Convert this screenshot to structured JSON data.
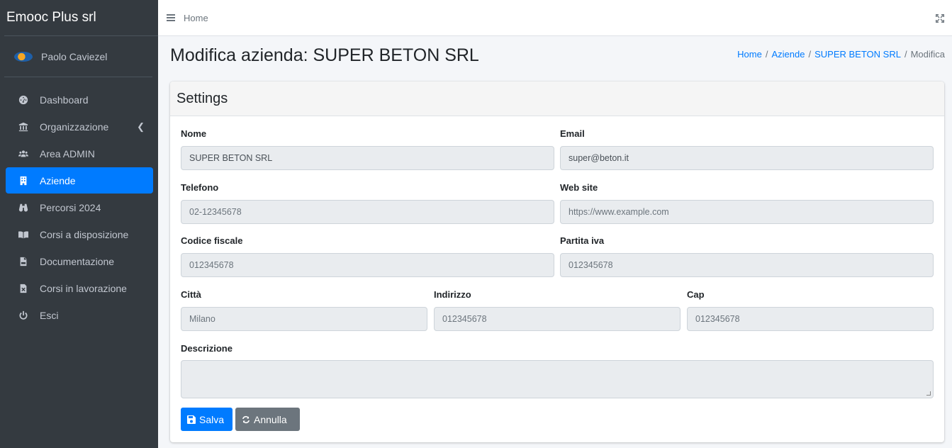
{
  "app": {
    "brand": "Emooc Plus srl"
  },
  "user": {
    "name": "Paolo Caviezel"
  },
  "sidebar": {
    "items": [
      {
        "label": "Dashboard",
        "icon": "tachometer-icon"
      },
      {
        "label": "Organizzazione",
        "icon": "bank-icon"
      },
      {
        "label": "Area ADMIN",
        "icon": "users-icon"
      },
      {
        "label": "Aziende",
        "icon": "building-icon",
        "active": true
      },
      {
        "label": "Percorsi 2024",
        "icon": "binoculars-icon"
      },
      {
        "label": "Corsi a disposizione",
        "icon": "book-open-icon"
      },
      {
        "label": "Documentazione",
        "icon": "pdf-file-icon"
      },
      {
        "label": "Corsi in lavorazione",
        "icon": "excel-file-icon"
      },
      {
        "label": "Esci",
        "icon": "power-icon"
      }
    ]
  },
  "topbar": {
    "home": "Home"
  },
  "page": {
    "title": "Modifica azienda: SUPER BETON SRL"
  },
  "breadcrumb": {
    "home": "Home",
    "aziende": "Aziende",
    "company": "SUPER BETON SRL",
    "current": "Modifica",
    "sep": "/"
  },
  "card": {
    "title": "Settings"
  },
  "form": {
    "nome": {
      "label": "Nome",
      "value": "SUPER BETON SRL"
    },
    "email": {
      "label": "Email",
      "value": "super@beton.it"
    },
    "telefono": {
      "label": "Telefono",
      "value": "02-12345678"
    },
    "website": {
      "label": "Web site",
      "placeholder": "https://www.example.com"
    },
    "codice_fiscale": {
      "label": "Codice fiscale",
      "value": "012345678"
    },
    "partita_iva": {
      "label": "Partita iva",
      "value": "012345678"
    },
    "citta": {
      "label": "Città",
      "value": "Milano"
    },
    "indirizzo": {
      "label": "Indirizzo",
      "value": "012345678"
    },
    "cap": {
      "label": "Cap",
      "value": "012345678"
    },
    "descrizione": {
      "label": "Descrizione",
      "value": ""
    }
  },
  "buttons": {
    "save": "Salva",
    "cancel": "Annulla"
  },
  "colors": {
    "primary": "#007bff",
    "sidebar": "#343a40",
    "secondary": "#6c757d"
  }
}
